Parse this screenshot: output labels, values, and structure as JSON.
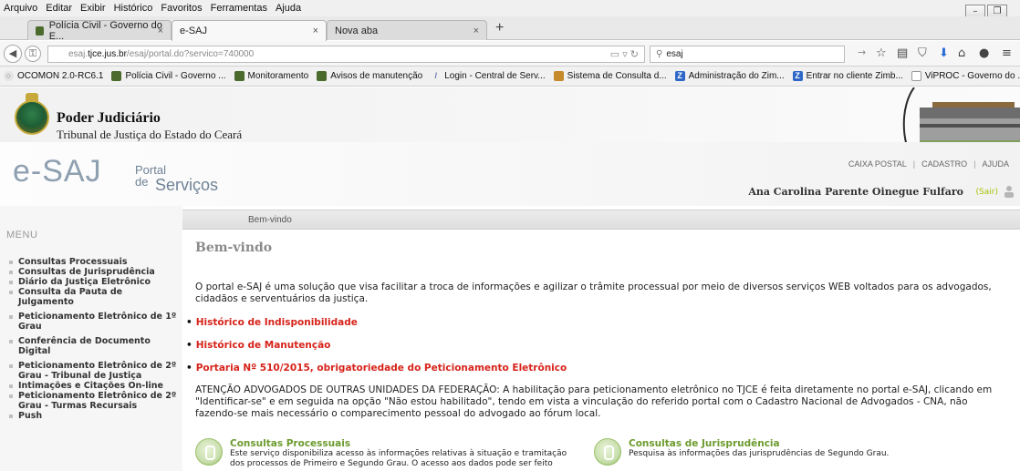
{
  "browser": {
    "menu": [
      "Arquivo",
      "Editar",
      "Exibir",
      "Histórico",
      "Favoritos",
      "Ferramentas",
      "Ajuda"
    ],
    "tabs": [
      {
        "title": "Polícia Civil - Governo do E...",
        "active": false
      },
      {
        "title": "e-SAJ",
        "active": true
      },
      {
        "title": "Nova aba",
        "active": false
      }
    ],
    "url_prefix": "esaj.",
    "url_host": "tjce.jus.br",
    "url_path": "/esaj/portal.do?servico=740000",
    "search_value": "esaj",
    "bookmarks": [
      {
        "label": "OCOMON 2.0-RC6.1",
        "icon": "globe-icon"
      },
      {
        "label": "Polícia Civil - Governo ...",
        "icon": "seal-icon"
      },
      {
        "label": "Monitoramento",
        "icon": "seal-icon"
      },
      {
        "label": "Avisos de manutenção",
        "icon": "seal-icon"
      },
      {
        "label": "Login - Central de Serv...",
        "icon": "wand-icon"
      },
      {
        "label": "Sistema de Consulta d...",
        "icon": "book-icon"
      },
      {
        "label": "Administração do Zim...",
        "icon": "zimbra-icon"
      },
      {
        "label": "Entrar no cliente Zimb...",
        "icon": "zimbra-icon"
      },
      {
        "label": "ViPROC - Governo do ...",
        "icon": "page-icon"
      }
    ]
  },
  "header": {
    "title": "Poder Judiciário",
    "subtitle": "Tribunal de Justiça do Estado do Ceará"
  },
  "logo": {
    "main": "e-SAJ",
    "portal": "Portal",
    "de": "de",
    "servicos": "Serviços"
  },
  "toplinks": [
    "CAIXA POSTAL",
    "CADASTRO",
    "AJUDA"
  ],
  "user": {
    "name": "Ana Carolina Parente Oinegue Fulfaro",
    "sair": "(Sair)"
  },
  "breadcrumb": "Bem-vindo",
  "sidebar": {
    "title": "MENU",
    "items": [
      [
        "Consultas Processuais"
      ],
      [
        "Consultas de Jurisprudência"
      ],
      [
        "Diário da Justiça Eletrônico"
      ],
      [
        "Consulta da Pauta de",
        "Julgamento"
      ],
      [
        "Peticionamento Eletrônico de 1º",
        "Grau"
      ],
      [
        "Conferência de Documento",
        "Digital"
      ],
      [
        "Peticionamento Eletrônico de 2º",
        "Grau - Tribunal de Justiça"
      ],
      [
        "Intimações e Citações On-line"
      ],
      [
        "Peticionamento Eletrônico de 2º",
        "Grau - Turmas Recursais"
      ],
      [
        "Push"
      ]
    ]
  },
  "main": {
    "heading": "Bem-vindo",
    "intro": "O portal e-SAJ é uma solução que visa facilitar a troca de informações e agilizar o trâmite processual por meio de diversos serviços WEB voltados para os advogados, cidadãos e serventuários da justiça.",
    "links": [
      "Histórico de Indisponibilidade",
      "Histórico de Manutenção",
      "Portaria Nº 510/2015, obrigatoriedade do Peticionamento Eletrônico"
    ],
    "notice": "ATENÇÃO ADVOGADOS DE OUTRAS UNIDADES DA FEDERAÇÃO: A habilitação para peticionamento eletrônico no TJCE é feita diretamente no portal e-SAJ, clicando em \"Identificar-se\" e em seguida na opção \"Não estou habilitado\", tendo em vista a vinculação do referido portal com o Cadastro Nacional de Advogados - CNA, não fazendo-se mais necessário o comparecimento pessoal do advogado ao fórum local.",
    "services": [
      {
        "title": "Consultas Processuais",
        "desc_1": "Este serviço disponibiliza acesso às informações relativas à situação e tramitação",
        "desc_2": "dos processos de Primeiro e Segundo Grau. O acesso aos dados pode ser feito"
      },
      {
        "title": "Consultas de Jurisprudência",
        "desc_1": "Pesquisa às informações das jurisprudências de Segundo Grau.",
        "desc_2": ""
      }
    ]
  },
  "colors": {
    "accent_red": "#d6231a",
    "service_green": "#6c9b2e",
    "logo_blue": "#8e9fb0"
  }
}
